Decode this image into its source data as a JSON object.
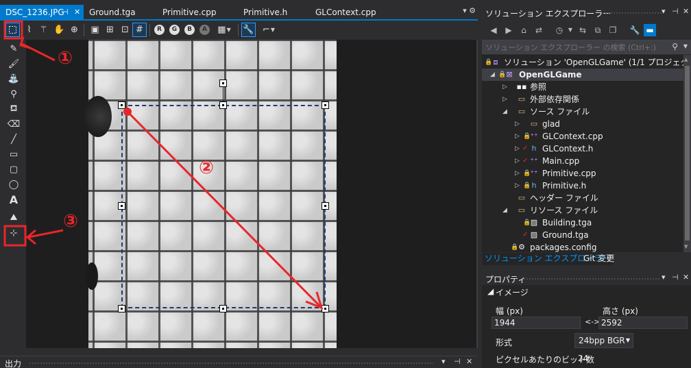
{
  "tabs": [
    {
      "label": "DSC_1236.JPG",
      "active": true
    },
    {
      "label": "Ground.tga"
    },
    {
      "label": "Primitive.cpp"
    },
    {
      "label": "Primitive.h"
    },
    {
      "label": "GLContext.cpp"
    }
  ],
  "toolbar": {
    "red_label": "R",
    "green_label": "G",
    "blue_label": "B",
    "alpha_label": "A"
  },
  "tools": {
    "text_tool_glyph": "A"
  },
  "annotations": {
    "one": "①",
    "two": "②",
    "three": "③",
    "color": "#e8262a",
    "selection_color": "#1a3a78"
  },
  "output_panel": {
    "title": "出力"
  },
  "solution_explorer": {
    "title": "ソリューション エクスプローラー",
    "search_placeholder": "ソリューション エクスプローラー の検索 (Ctrl+:)",
    "tree": [
      {
        "label": "ソリューション 'OpenGLGame' (1/1 プロジェクト)",
        "icon": "solution-icon"
      },
      {
        "label": "OpenGLGame",
        "icon": "project-icon",
        "bold": true,
        "selected": true
      },
      {
        "label": "参照",
        "icon": "references-icon"
      },
      {
        "label": "外部依存関係",
        "icon": "external-deps-icon"
      },
      {
        "label": "ソース ファイル",
        "icon": "folder-icon"
      },
      {
        "label": "glad",
        "icon": "folder-icon"
      },
      {
        "label": "GLContext.cpp",
        "icon": "cpp-file-icon"
      },
      {
        "label": "GLContext.h",
        "icon": "header-file-icon"
      },
      {
        "label": "Main.cpp",
        "icon": "cpp-file-icon"
      },
      {
        "label": "Primitive.cpp",
        "icon": "cpp-file-icon"
      },
      {
        "label": "Primitive.h",
        "icon": "header-file-icon"
      },
      {
        "label": "ヘッダー ファイル",
        "icon": "folder-icon"
      },
      {
        "label": "リソース ファイル",
        "icon": "folder-icon"
      },
      {
        "label": "Building.tga",
        "icon": "image-file-icon"
      },
      {
        "label": "Ground.tga",
        "icon": "image-file-icon"
      },
      {
        "label": "packages.config",
        "icon": "config-file-icon"
      }
    ],
    "bottom_tabs": [
      {
        "label": "ソリューション エクスプローラー",
        "active": true
      },
      {
        "label": "Git 変更"
      }
    ]
  },
  "properties": {
    "title": "プロパティ",
    "section": "イメージ",
    "width_label": "幅 (px)",
    "height_label": "高さ (px)",
    "width_value": "1944",
    "height_value": "2592",
    "format_label": "形式",
    "format_value": "24bpp BGR",
    "bpp_label": "ピクセルあたりのビット数",
    "bpp_value": "24"
  }
}
